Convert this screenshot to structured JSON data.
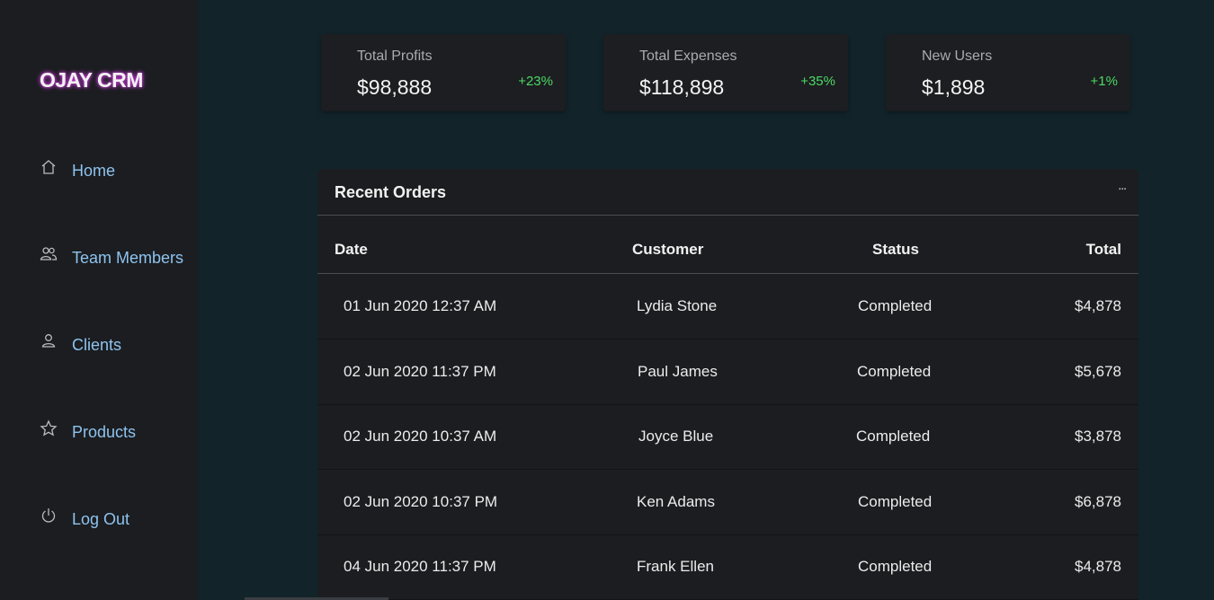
{
  "app": {
    "name": "OJAY CRM"
  },
  "sidebar": {
    "items": [
      {
        "label": "Home",
        "icon": "home-icon"
      },
      {
        "label": "Team Members",
        "icon": "team-icon"
      },
      {
        "label": "Clients",
        "icon": "user-icon"
      },
      {
        "label": "Products",
        "icon": "star-icon"
      },
      {
        "label": "Log Out",
        "icon": "power-icon"
      }
    ]
  },
  "stats": [
    {
      "title": "Total Profits",
      "value": "$98,888",
      "change": "+23%"
    },
    {
      "title": "Total Expenses",
      "value": "$118,898",
      "change": "+35%"
    },
    {
      "title": "New Users",
      "value": "$1,898",
      "change": "+1%"
    }
  ],
  "orders": {
    "title": "Recent Orders",
    "more": "...",
    "columns": [
      "Date",
      "Customer",
      "Status",
      "Total"
    ],
    "rows": [
      [
        "01 Jun 2020 12:37 AM",
        "Lydia Stone",
        "Completed",
        "$4,878"
      ],
      [
        "02 Jun 2020 11:37 PM",
        "Paul James",
        "Completed",
        "$5,678"
      ],
      [
        "02 Jun 2020 10:37 AM",
        "Joyce Blue",
        "Completed",
        "$3,878"
      ],
      [
        "02 Jun 2020 10:37 PM",
        "Ken Adams",
        "Completed",
        "$6,878"
      ],
      [
        "04 Jun 2020 11:37 PM",
        "Frank Ellen",
        "Completed",
        "$4,878"
      ]
    ]
  },
  "colors": {
    "accent_link": "#8ec3ef",
    "positive_change": "#4cd964",
    "logo_glow": "#c83bd8",
    "background": "#12242a",
    "panel": "#1b1d20"
  }
}
